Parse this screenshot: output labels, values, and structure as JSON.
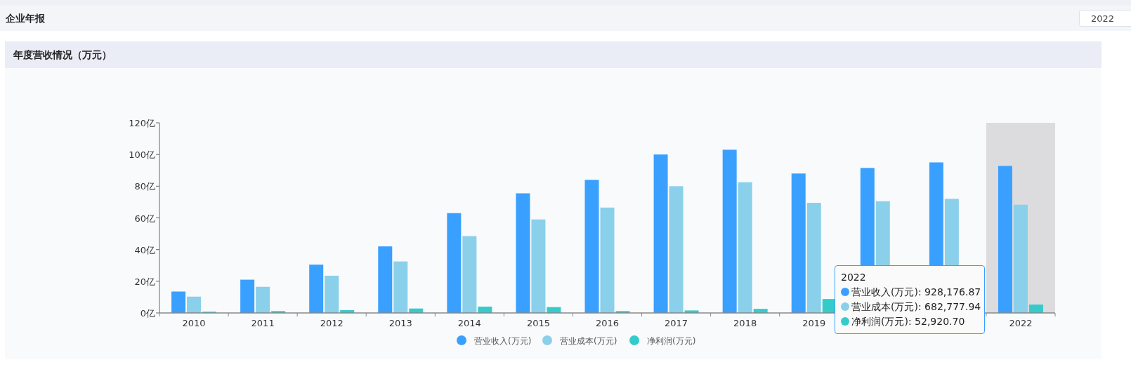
{
  "header": {
    "title": "企业年报",
    "year_select": {
      "value": "2022"
    }
  },
  "panel": {
    "title": "年度营收情况（万元）",
    "chart_data": {
      "type": "bar",
      "x": [
        2010,
        2011,
        2012,
        2013,
        2014,
        2015,
        2016,
        2017,
        2018,
        2019,
        2020,
        2021,
        2022
      ],
      "xticks": [
        {
          "value": 2010,
          "label": "2010"
        },
        {
          "value": 2011,
          "label": "2011"
        },
        {
          "value": 2012,
          "label": "2012"
        },
        {
          "value": 2013,
          "label": "2013"
        },
        {
          "value": 2014,
          "label": "2014"
        },
        {
          "value": 2015,
          "label": "2015"
        },
        {
          "value": 2016,
          "label": "2016"
        },
        {
          "value": 2017,
          "label": "2017"
        },
        {
          "value": 2018,
          "label": "2018"
        },
        {
          "value": 2019,
          "label": "2019"
        },
        {
          "value": 2022,
          "label": "2022"
        }
      ],
      "series": [
        {
          "name": "营业收入(万元)",
          "color": "#3aa0ff",
          "values": [
            13.5,
            21,
            30.5,
            42,
            63,
            75.5,
            84,
            100,
            103,
            88,
            91.5,
            95,
            92.8
          ]
        },
        {
          "name": "营业成本(万元)",
          "color": "#8ad0ea",
          "values": [
            10.3,
            16.5,
            23.5,
            32.5,
            48.5,
            59,
            66.5,
            80,
            82.5,
            69.5,
            70.5,
            72,
            68.3
          ]
        },
        {
          "name": "净利润(万元)",
          "color": "#36cbcb",
          "values": [
            0.8,
            1.2,
            1.8,
            2.8,
            4,
            3.7,
            1.2,
            1.6,
            2.6,
            8.8,
            null,
            null,
            5.3
          ]
        }
      ],
      "ylim": [
        0,
        120
      ],
      "yticks": [
        {
          "value": 0,
          "label": "0亿"
        },
        {
          "value": 20,
          "label": "20亿"
        },
        {
          "value": 40,
          "label": "40亿"
        },
        {
          "value": 60,
          "label": "60亿"
        },
        {
          "value": 80,
          "label": "80亿"
        },
        {
          "value": 100,
          "label": "100亿"
        },
        {
          "value": 120,
          "label": "120亿"
        }
      ],
      "xlim": [
        2009.5,
        2022.5
      ],
      "legend": true,
      "bands": [
        {
          "axis": "x",
          "from": 2021.5,
          "to": 2022.5
        }
      ]
    },
    "tooltip": {
      "title": "2022",
      "items": [
        {
          "text": "营业收入(万元): 928,176.87",
          "color": "#3aa0ff"
        },
        {
          "text": "营业成本(万元): 682,777.94",
          "color": "#8ad0ea"
        },
        {
          "text": "净利润(万元): 52,920.70",
          "color": "#36cbcb"
        }
      ]
    }
  }
}
